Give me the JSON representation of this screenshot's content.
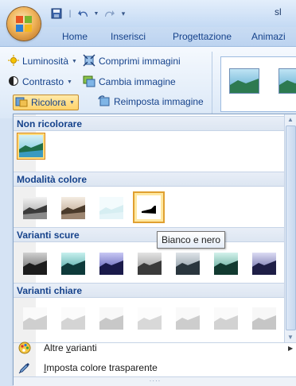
{
  "title_bar": {
    "title": "sl"
  },
  "tabs": [
    "Home",
    "Inserisci",
    "Progettazione",
    "Animazi"
  ],
  "ribbon": {
    "adjust": {
      "brightness": "Luminosità",
      "contrast": "Contrasto",
      "recolor": "Ricolora",
      "compress": "Comprimi immagini",
      "change": "Cambia immagine",
      "reset": "Reimposta immagine"
    }
  },
  "recolor_menu": {
    "sections": {
      "no_recolor": "Non ricolorare",
      "color_modes": "Modalità colore",
      "dark_variants": "Varianti scure",
      "light_variants": "Varianti chiare"
    },
    "tooltip": "Bianco e nero",
    "more_variants_label": "Altre varianti",
    "more_variants_accel": "v",
    "set_transparent_label": "Imposta colore trasparente",
    "set_transparent_accel": "I"
  }
}
